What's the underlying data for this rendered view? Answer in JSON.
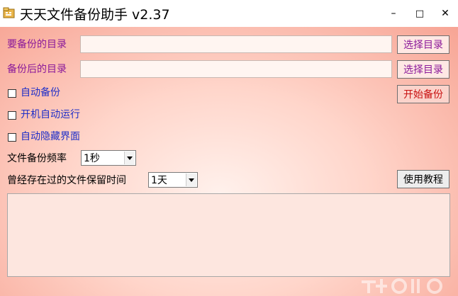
{
  "window": {
    "title": "天天文件备份助手 v2.37",
    "controls": {
      "minimize": "–",
      "maximize": "□",
      "close": "✕"
    }
  },
  "form": {
    "source_dir_label": "要备份的目录",
    "source_dir_value": "",
    "dest_dir_label": "备份后的目录",
    "dest_dir_value": "",
    "choose_dir_button": "选择目录",
    "choose_dir_button_2": "选择目录",
    "start_backup_button": "开始备份",
    "tutorial_button": "使用教程",
    "options": [
      {
        "label": "自动备份",
        "checked": false
      },
      {
        "label": "开机自动运行",
        "checked": false
      },
      {
        "label": "自动隐藏界面",
        "checked": false
      }
    ],
    "frequency_label": "文件备份频率",
    "frequency_value": "1秒",
    "retention_label": "曾经存在过的文件保留时间",
    "retention_value": "1天",
    "log_text": ""
  },
  "colors": {
    "label_purple": "#8b1a9a",
    "option_blue": "#1f2fc8",
    "start_red": "#c81010",
    "background_gradient_edge": "#f7a494"
  },
  "icons": [
    "app-icon",
    "minimize-icon",
    "maximize-icon",
    "close-icon",
    "dropdown-arrow-icon"
  ]
}
